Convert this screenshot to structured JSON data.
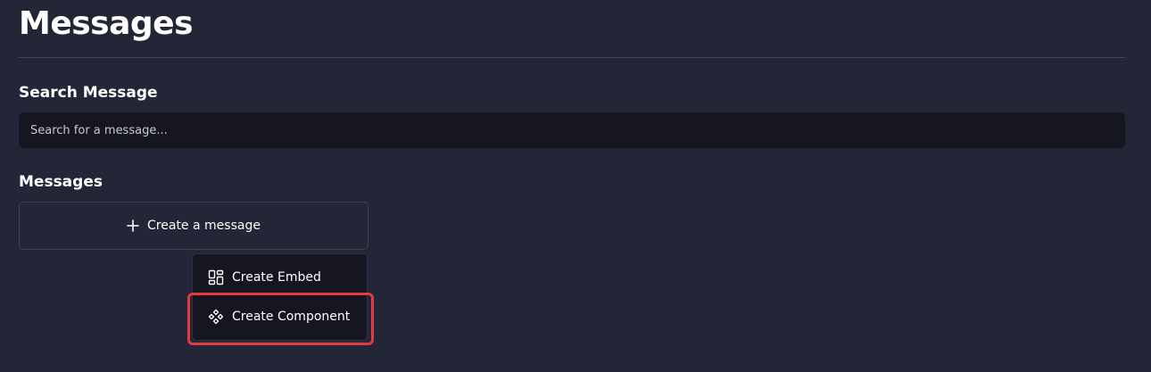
{
  "page": {
    "title": "Messages"
  },
  "search": {
    "heading": "Search Message",
    "placeholder": "Search for a message...",
    "value": ""
  },
  "messages": {
    "heading": "Messages",
    "create_button_label": "Create a message",
    "create_button_icon": "plus-icon"
  },
  "dropdown": {
    "items": [
      {
        "label": "Create Embed",
        "icon": "layout-grid-icon"
      },
      {
        "label": "Create Component",
        "icon": "component-diamonds-icon",
        "highlighted": true
      }
    ]
  },
  "colors": {
    "background": "#222637",
    "input_background": "#151620",
    "highlight": "#e33a3f"
  }
}
